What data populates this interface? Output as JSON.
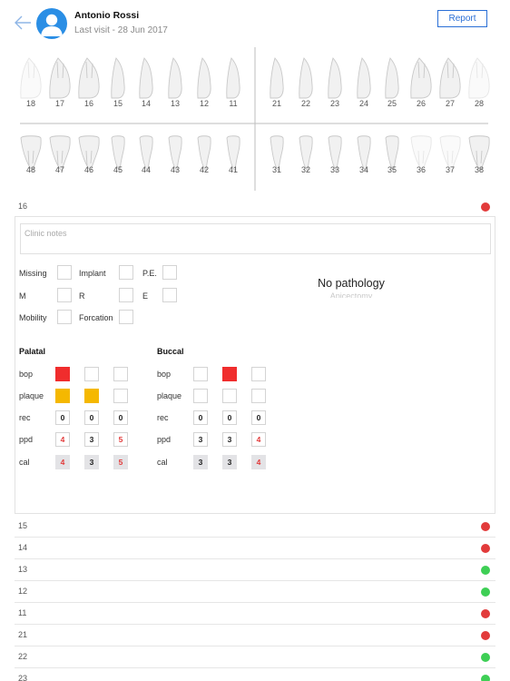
{
  "header": {
    "patient_name": "Antonio Rossi",
    "last_visit": "Last visit - 28 Jun 2017",
    "report_label": "Report"
  },
  "teeth": {
    "upper_left": [
      "18",
      "17",
      "16",
      "15",
      "14",
      "13",
      "12",
      "11"
    ],
    "upper_right": [
      "21",
      "22",
      "23",
      "24",
      "25",
      "26",
      "27",
      "28"
    ],
    "lower_left": [
      "48",
      "47",
      "46",
      "45",
      "44",
      "43",
      "42",
      "41"
    ],
    "lower_right": [
      "31",
      "32",
      "33",
      "34",
      "35",
      "36",
      "37",
      "38"
    ]
  },
  "selected": {
    "tooth": "16",
    "status_color": "#e23b3b",
    "notes_placeholder": "Clinic notes",
    "flags": {
      "missing": "Missing",
      "implant": "Implant",
      "pe": "P.E.",
      "m": "M",
      "r": "R",
      "e": "E",
      "mobility": "Mobility",
      "forcation": "Forcation"
    },
    "pathology": "No pathology",
    "pathology_next": "Apicectomy",
    "palatal": {
      "title": "Palatal",
      "bop_label": "bop",
      "plaque_label": "plaque",
      "rec_label": "rec",
      "ppd_label": "ppd",
      "cal_label": "cal",
      "bop_colors": [
        "#f02d2d",
        "",
        ""
      ],
      "plaque_colors": [
        "#f5b800",
        "#f5b800",
        ""
      ],
      "rec": [
        "0",
        "0",
        "0"
      ],
      "ppd": [
        "4",
        "3",
        "5"
      ],
      "cal": [
        "4",
        "3",
        "5"
      ]
    },
    "buccal": {
      "title": "Buccal",
      "bop_label": "bop",
      "plaque_label": "plaque",
      "rec_label": "rec",
      "ppd_label": "ppd",
      "cal_label": "cal",
      "bop_colors": [
        "",
        "#f02d2d",
        ""
      ],
      "plaque_colors": [
        "",
        "",
        ""
      ],
      "rec": [
        "0",
        "0",
        "0"
      ],
      "ppd": [
        "3",
        "3",
        "4"
      ],
      "cal": [
        "3",
        "3",
        "4"
      ]
    }
  },
  "tooth_list": [
    {
      "num": "15",
      "color": "#e23b3b"
    },
    {
      "num": "14",
      "color": "#e23b3b"
    },
    {
      "num": "13",
      "color": "#3ecf55"
    },
    {
      "num": "12",
      "color": "#3ecf55"
    },
    {
      "num": "11",
      "color": "#e23b3b"
    },
    {
      "num": "21",
      "color": "#e23b3b"
    },
    {
      "num": "22",
      "color": "#3ecf55"
    },
    {
      "num": "23",
      "color": "#3ecf55"
    }
  ],
  "colors": {
    "accent": "#2a6fd6",
    "avatar": "#2a8ee5",
    "red": "#e23b3b",
    "green": "#3ecf55",
    "amber": "#f5b800"
  }
}
